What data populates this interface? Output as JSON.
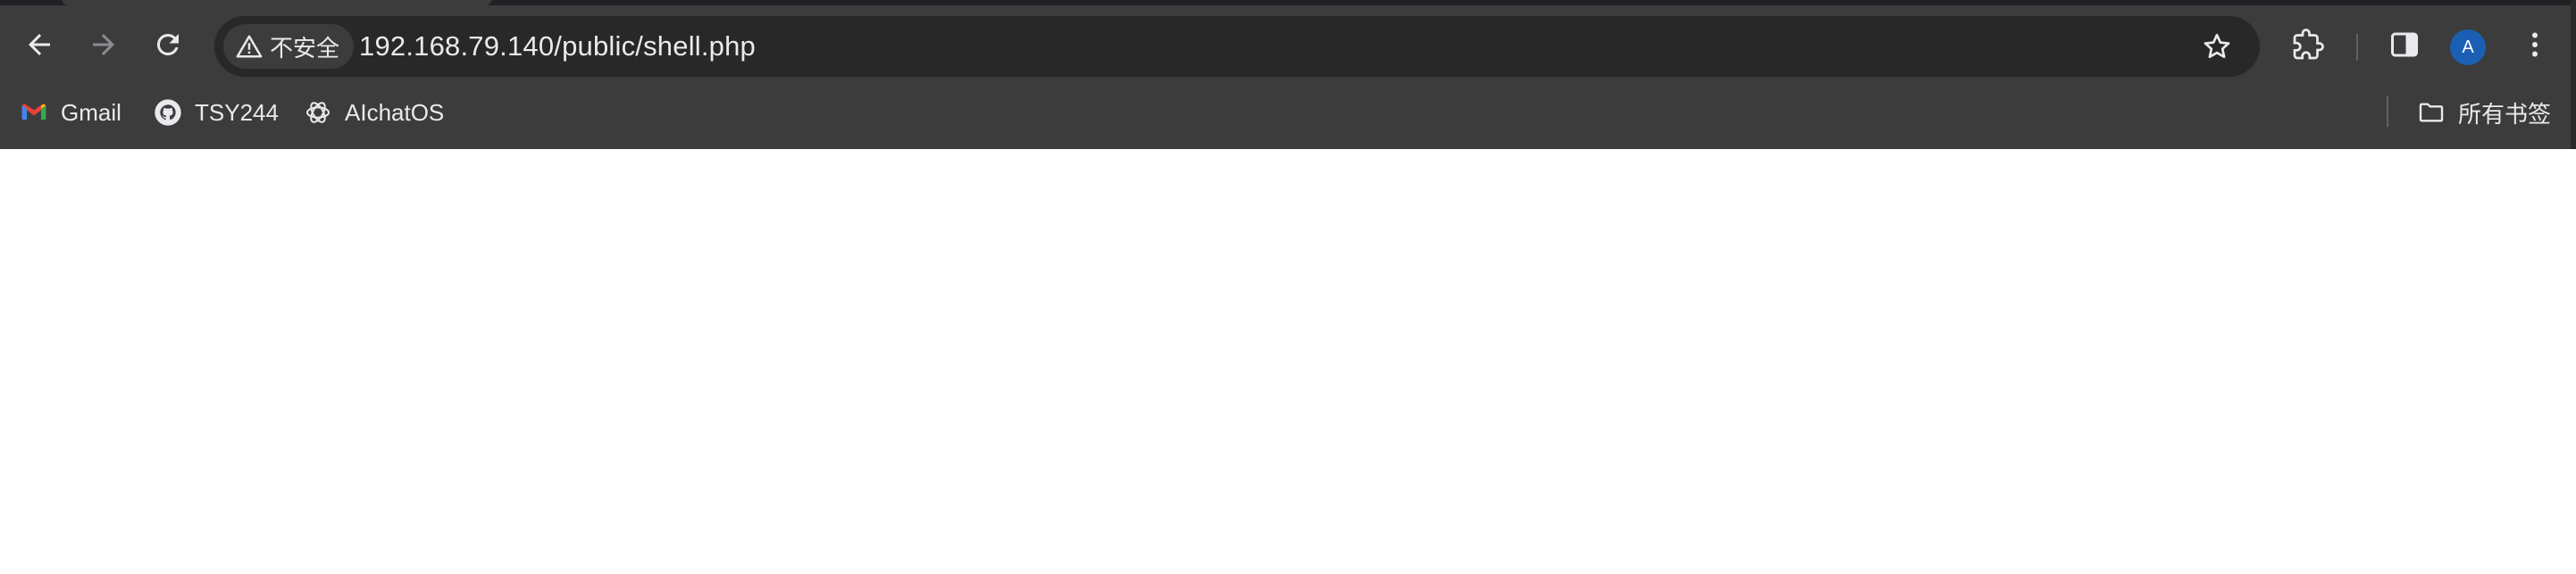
{
  "address_bar": {
    "security_label": "不安全",
    "url": "192.168.79.140/public/shell.php"
  },
  "toolbar": {
    "back": "arrow-left-icon",
    "forward": "arrow-right-icon",
    "reload": "reload-icon",
    "bookmark_star": "star-icon",
    "extensions": "puzzle-icon",
    "side_panel": "side-panel-icon",
    "profile_initial": "A",
    "menu": "kebab-menu-icon"
  },
  "bookmarks": {
    "items": [
      {
        "label": "Gmail",
        "icon": "gmail-icon"
      },
      {
        "label": "TSY244",
        "icon": "github-icon"
      },
      {
        "label": "AIchatOS",
        "icon": "openai-icon"
      }
    ],
    "all_bookmarks_label": "所有书签"
  },
  "colors": {
    "chrome_bg": "#3c3c3c",
    "omnibox_bg": "#282828",
    "text": "#e8eaed",
    "avatar_bg": "#1a5fb4",
    "page_bg": "#ffffff"
  }
}
